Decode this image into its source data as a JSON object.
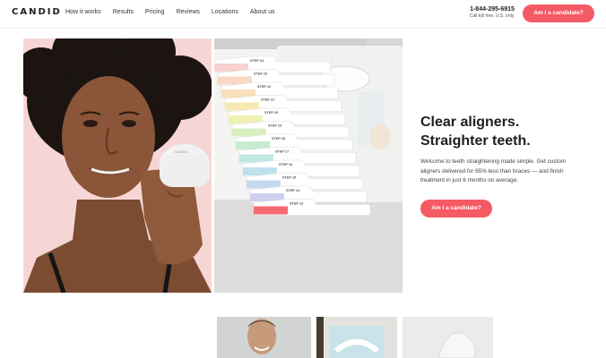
{
  "brand": {
    "logo": "CANDID",
    "accent": "#f45a63"
  },
  "nav": {
    "links": [
      "How it works",
      "Results",
      "Pricing",
      "Reviews",
      "Locations",
      "About us"
    ],
    "phone": "1-844-295-6915",
    "phone_note": "Call toll free, U.S. only.",
    "cta": "Am I a candidate?"
  },
  "hero": {
    "headline_line1": "Clear aligners.",
    "headline_line2": "Straighter teeth.",
    "description": "Welcome to teeth straightening made simple. Get custom aligners delivered for 65% less than braces — and finish treatment in just 6 months on average.",
    "cta": "Am I a candidate?",
    "case_label": "CANDID",
    "steps": [
      "STEP 24",
      "STEP 23",
      "STEP 22",
      "STEP 21",
      "STEP 20",
      "STEP 19",
      "STEP 18",
      "STEP 17",
      "STEP 16",
      "STEP 15",
      "STEP 14",
      "STEP 13"
    ],
    "step_colors": [
      "#f7d2cf",
      "#f9d8c6",
      "#f8e0b9",
      "#f6e9b0",
      "#eef0b4",
      "#d9efc0",
      "#c6ecd0",
      "#bfe8e0",
      "#c0e0ec",
      "#c6d8f0",
      "#cfd0ee",
      "#f36a71"
    ]
  }
}
